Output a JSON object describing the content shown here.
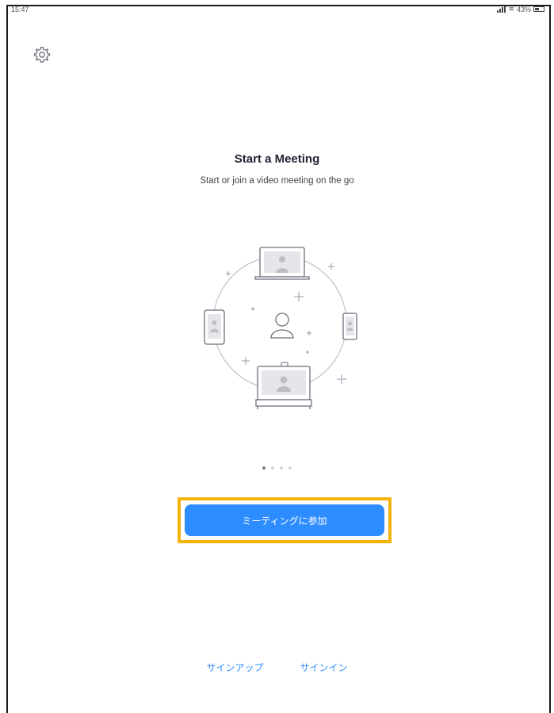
{
  "status_bar": {
    "time": "15:47",
    "battery": "43%"
  },
  "header": {
    "settings_icon": "gear-icon"
  },
  "carousel": {
    "title": "Start a Meeting",
    "subtitle": "Start or join a video meeting on the go",
    "page_count": 4,
    "active_page": 1
  },
  "actions": {
    "join_label": "ミーティングに参加",
    "sign_up_label": "サインアップ",
    "sign_in_label": "サインイン"
  },
  "colors": {
    "accent": "#2d8cff",
    "highlight": "#f2b30c"
  }
}
